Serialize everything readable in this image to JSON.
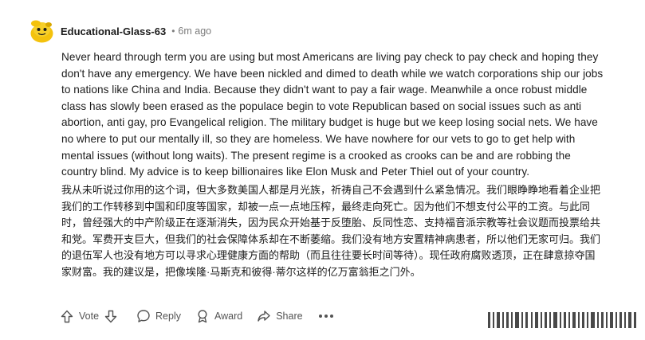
{
  "comment": {
    "username": "Educational-Glass-63",
    "separator": "•",
    "timestamp": "6m ago",
    "body_en": "Never heard through term you are using but most Americans are living pay check to pay check and hoping they don't have any emergency. We have been nickled and dimed to death while we watch corporations ship our jobs to nations like China and India. Because they didn't want to pay a fair wage. Meanwhile a once robust middle class has slowly been erased as the populace begin to vote Republican based on social issues such as anti abortion, anti gay, pro Evangelical religion. The military budget is huge but we keep losing social nets. We have no where to put our mentally ill, so they are homeless. We have nowhere for our vets to go to get help with mental issues (without long waits). The present regime is a crooked as crooks can be and are robbing the country blind. My advice is to keep billionaires like Elon Musk and Peter Thiel out of your country.",
    "body_zh": "我从未听说过你用的这个词，但大多数美国人都是月光族，祈祷自己不会遇到什么紧急情况。我们眼睁睁地看着企业把我们的工作转移到中国和印度等国家，却被一点一点地压榨，最终走向死亡。因为他们不想支付公平的工资。与此同时，曾经强大的中产阶级正在逐渐消失，因为民众开始基于反堕胎、反同性恋、支持福音派宗教等社会议题而投票给共和党。军费开支巨大，但我们的社会保障体系却在不断萎缩。我们没有地方安置精神病患者，所以他们无家可归。我们的退伍军人也没有地方可以寻求心理健康方面的帮助（而且往往要长时间等待）。现任政府腐败透顶，正在肆意掠夺国家财富。我的建议是，把像埃隆·马斯克和彼得·蒂尔这样的亿万富翁拒之门外。"
  },
  "actions": {
    "vote_label": "Vote",
    "reply_label": "Reply",
    "award_label": "Award",
    "share_label": "Share"
  },
  "icons": {
    "avatar": "snoo-avatar-icon",
    "upvote": "arrow-up-icon",
    "downvote": "arrow-down-icon",
    "reply": "speech-bubble-icon",
    "award": "award-ribbon-icon",
    "share": "share-arrow-icon",
    "more": "ellipsis-icon"
  },
  "colors": {
    "text": "#1c1c1c",
    "muted": "#7c7c7c",
    "action": "#545454",
    "avatar_yellow": "#f4c20d"
  }
}
